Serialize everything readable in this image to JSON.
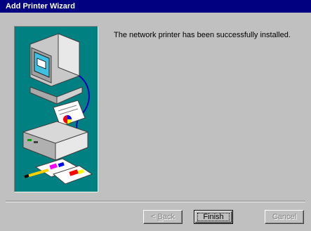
{
  "window": {
    "title": "Add Printer Wizard"
  },
  "content": {
    "message": "The network printer has been successfully installed."
  },
  "buttons": {
    "back_accel": "B",
    "back_rest": "ack",
    "back_prefix": "< ",
    "finish_label": "Finish",
    "cancel_label": "Cancel"
  },
  "colors": {
    "titlebar": "#000080",
    "illustration_bg": "#008080",
    "face": "#c0c0c0"
  },
  "icons": {
    "illustration": "computer-printer-illustration"
  }
}
